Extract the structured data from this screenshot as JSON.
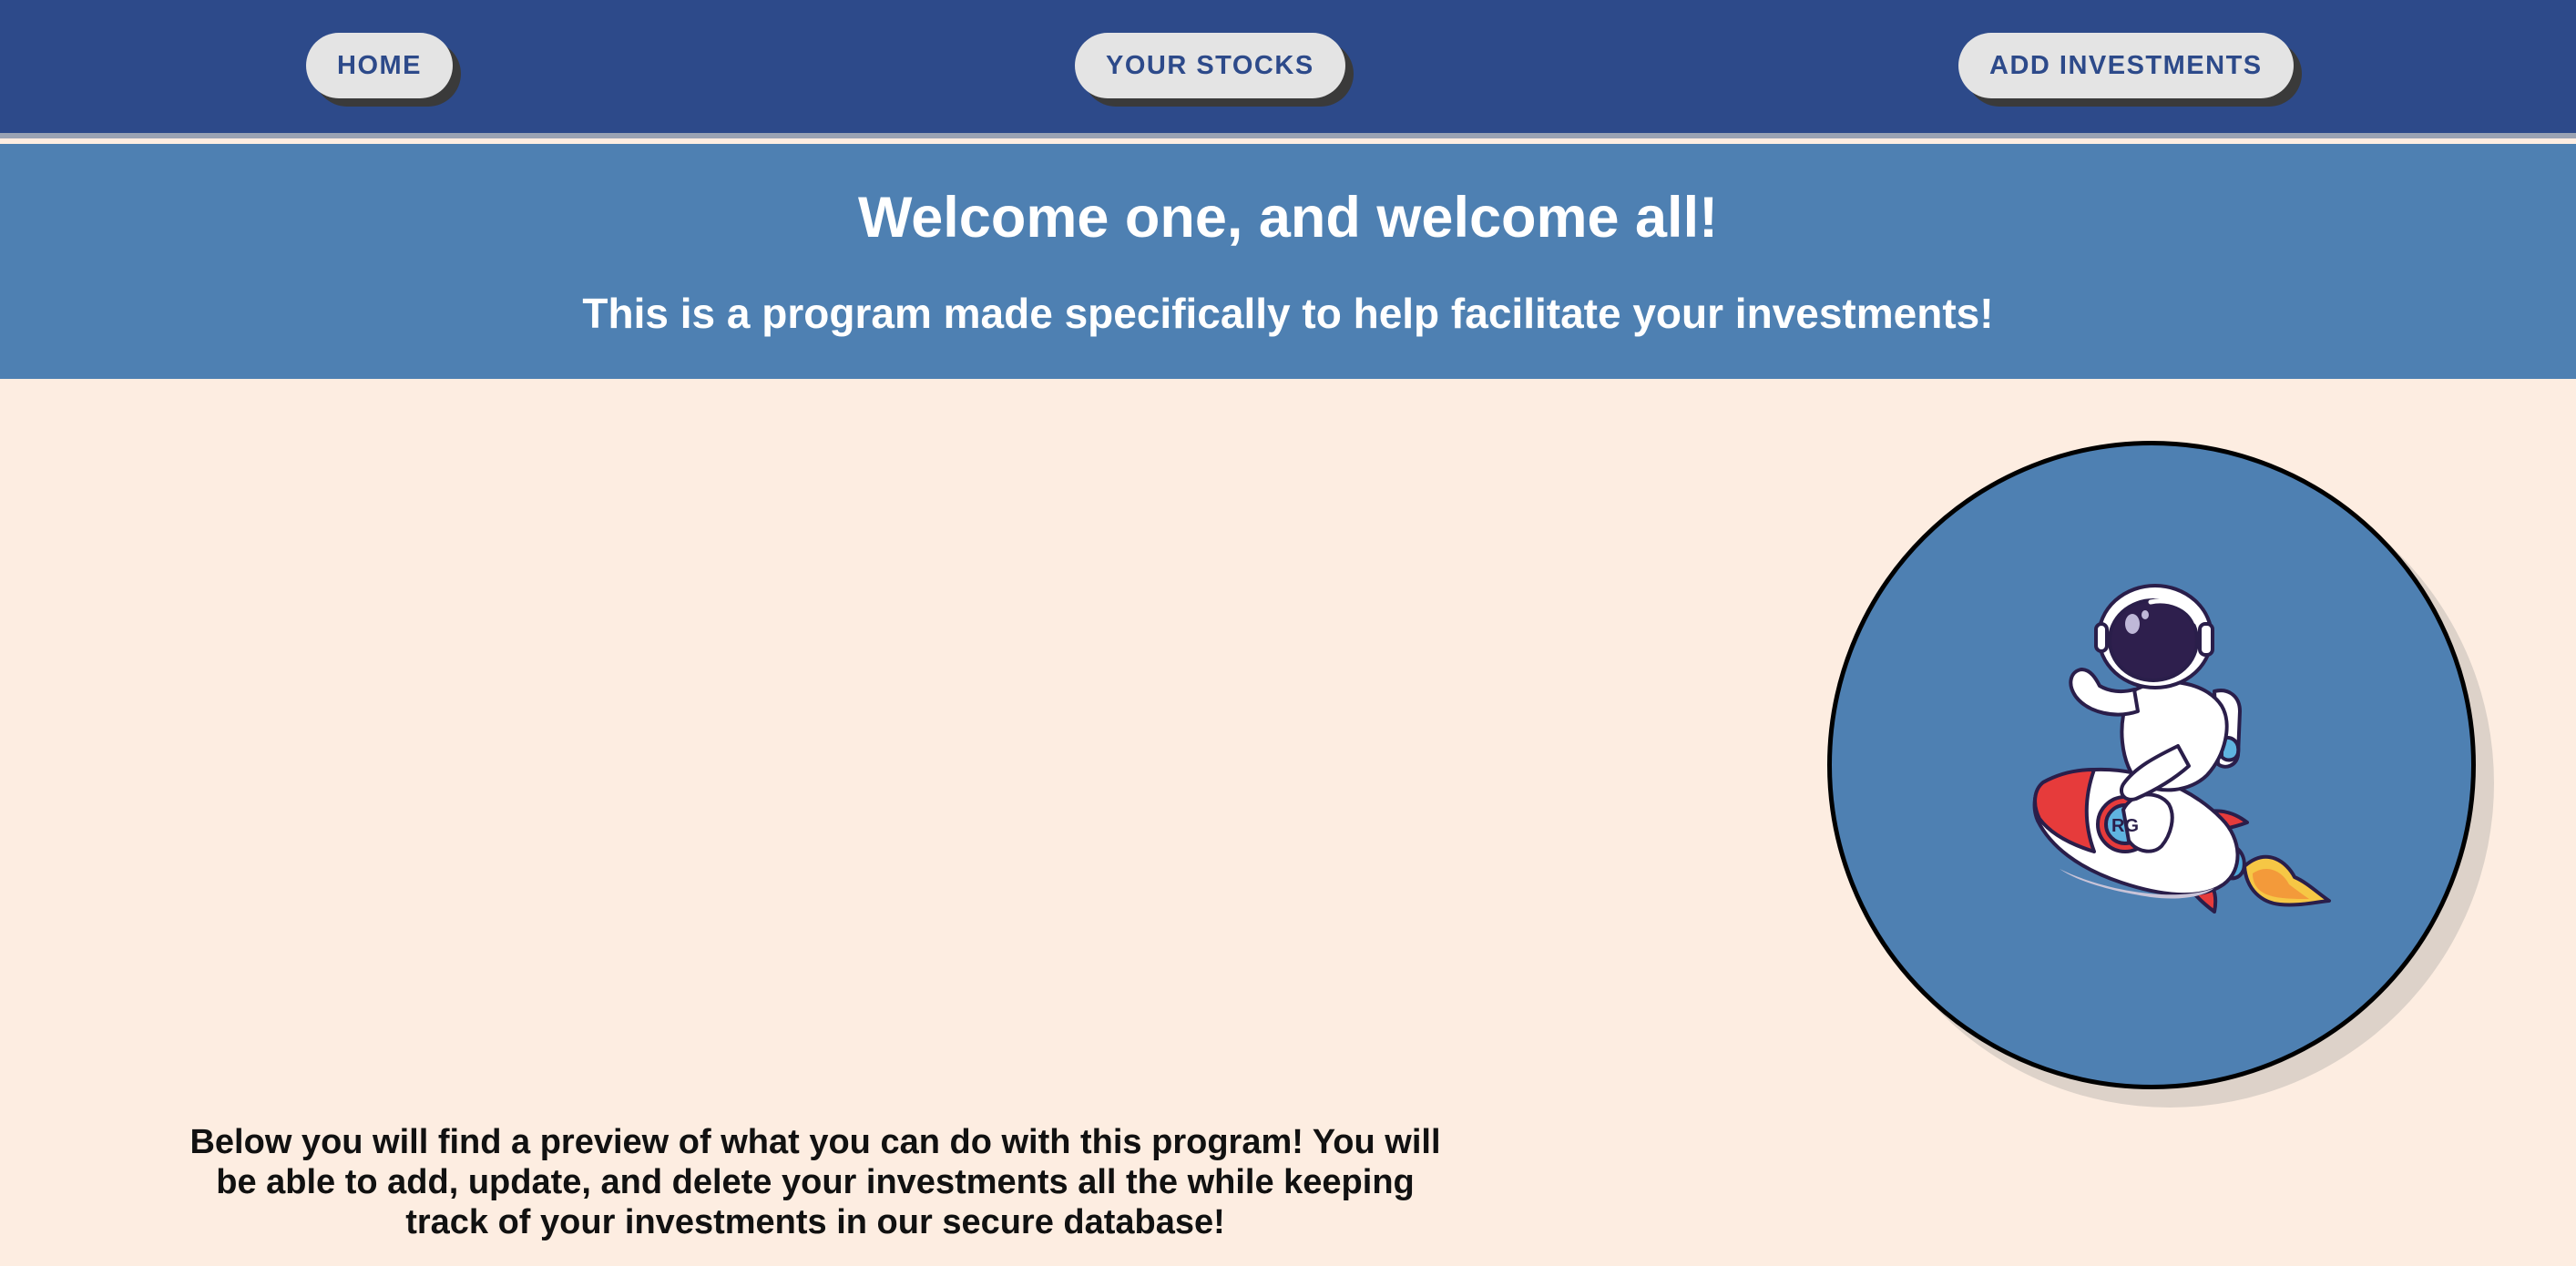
{
  "nav": {
    "home_label": "HOME",
    "stocks_label": "YOUR STOCKS",
    "add_label": "ADD INVESTMENTS"
  },
  "hero": {
    "title": "Welcome one, and welcome all!",
    "subtitle": "This is a program made specifically to help facilitate your investments!"
  },
  "illustration": {
    "icon": "astronaut-riding-rocket-icon",
    "badge_text": "RG"
  },
  "intro": {
    "text": "Below you will find a preview of what you can do with this program! You will be able to add, update, and delete your investments all the while keeping track of your investments in our secure database!"
  },
  "colors": {
    "nav_bg": "#2d4a8a",
    "hero_bg": "#4e80b2",
    "page_bg": "#fdede1",
    "button_bg": "#e4e4e4",
    "button_text": "#2d4a8a"
  }
}
